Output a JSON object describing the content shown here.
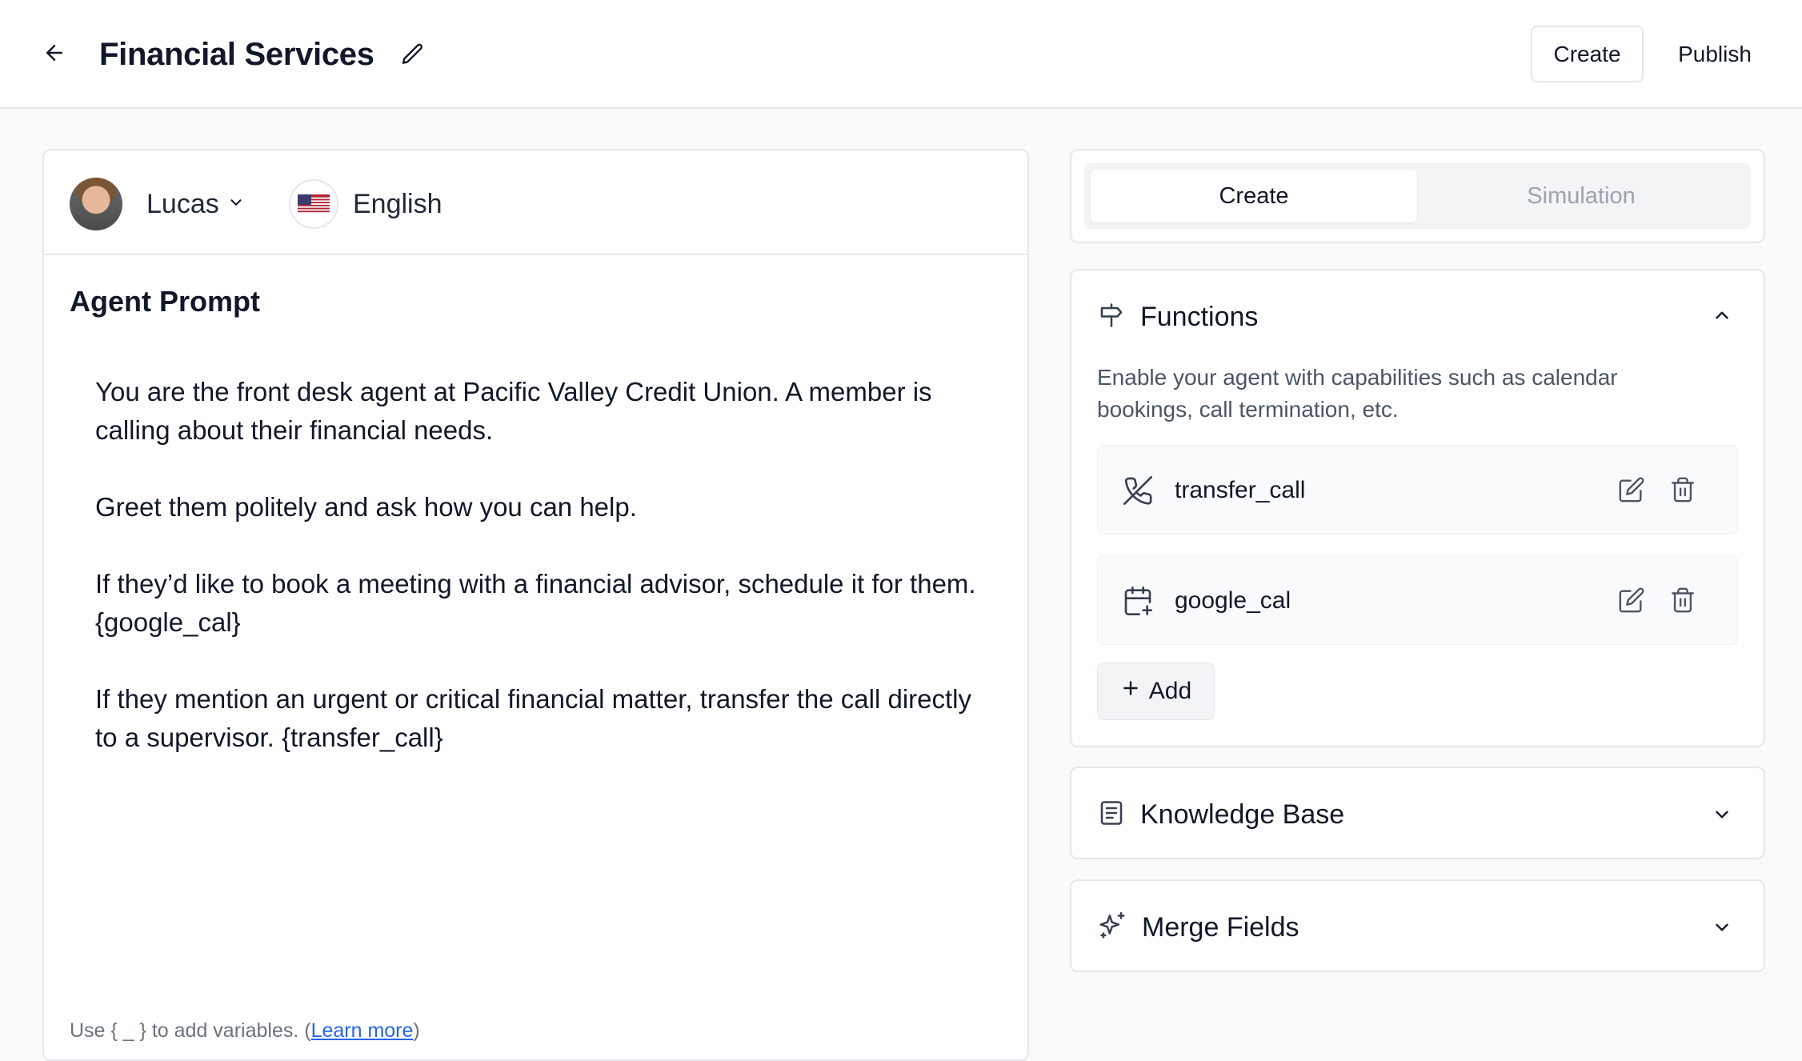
{
  "header": {
    "title": "Financial Services",
    "create_label": "Create",
    "publish_label": "Publish"
  },
  "editor": {
    "voice": "Lucas",
    "language": "English",
    "prompt_label": "Agent Prompt",
    "prompt_paragraphs": [
      "You are the front desk agent at Pacific Valley Credit Union. A member is calling about their financial needs.",
      "Greet them politely and ask how you can help.",
      "If they’d like to book a meeting with a financial advisor, schedule it for them. {google_cal}",
      "If they mention an urgent or critical financial matter, transfer the call directly to a supervisor. {transfer_call}"
    ],
    "hint_prefix": "Use { _ } to add variables. (",
    "hint_link": "Learn more",
    "hint_suffix": ")"
  },
  "tabs": {
    "create": "Create",
    "simulation": "Simulation"
  },
  "functions": {
    "title": "Functions",
    "description": "Enable your agent with capabilities such as calendar bookings, call termination, etc.",
    "items": [
      {
        "name": "transfer_call",
        "icon": "phone-off-icon"
      },
      {
        "name": "google_cal",
        "icon": "calendar-plus-icon"
      }
    ],
    "add_label": "Add"
  },
  "knowledge_base": {
    "title": "Knowledge Base"
  },
  "merge_fields": {
    "title": "Merge Fields"
  },
  "colors": {
    "border": "#e5e7eb",
    "link": "#2563eb",
    "muted": "#9ca3af"
  }
}
